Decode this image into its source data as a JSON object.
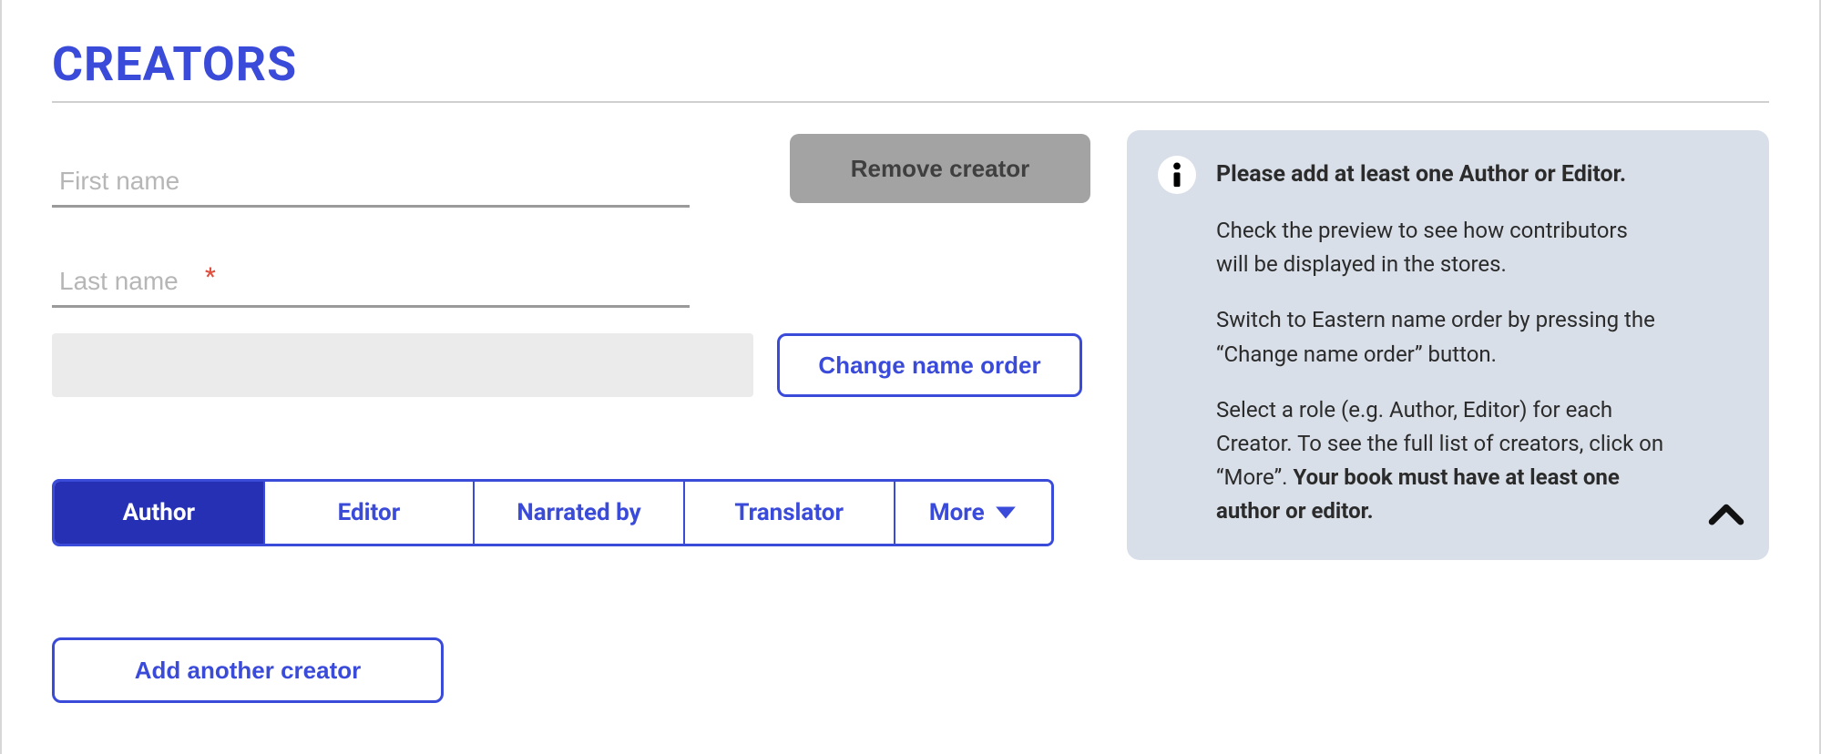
{
  "section": {
    "title": "CREATORS"
  },
  "creator": {
    "first_name_placeholder": "First name",
    "first_name_value": "",
    "last_name_placeholder": "Last name",
    "last_name_value": "",
    "required_mark": "*"
  },
  "buttons": {
    "remove_creator": "Remove creator",
    "change_name_order": "Change name order",
    "add_another_creator": "Add another creator"
  },
  "roles": {
    "items": [
      {
        "label": "Author"
      },
      {
        "label": "Editor"
      },
      {
        "label": "Narrated by"
      },
      {
        "label": "Translator"
      }
    ],
    "more_label": "More",
    "active_index": 0
  },
  "info": {
    "title": "Please add at least one Author or Editor.",
    "p1": "Check the preview to see how contributors will be displayed in the stores.",
    "p2": "Switch to Eastern name order by pressing the “Change name order” button.",
    "p3_a": "Select a role (e.g. Author, Editor) for each Creator. To see the full list of creators, click on “More”. ",
    "p3_b": "Your book must have at least one author or editor."
  },
  "colors": {
    "primary": "#3b4bd9",
    "primary_dark": "#2530b5",
    "muted_btn": "#a3a3a3",
    "panel_bg": "#d9dfe8"
  }
}
